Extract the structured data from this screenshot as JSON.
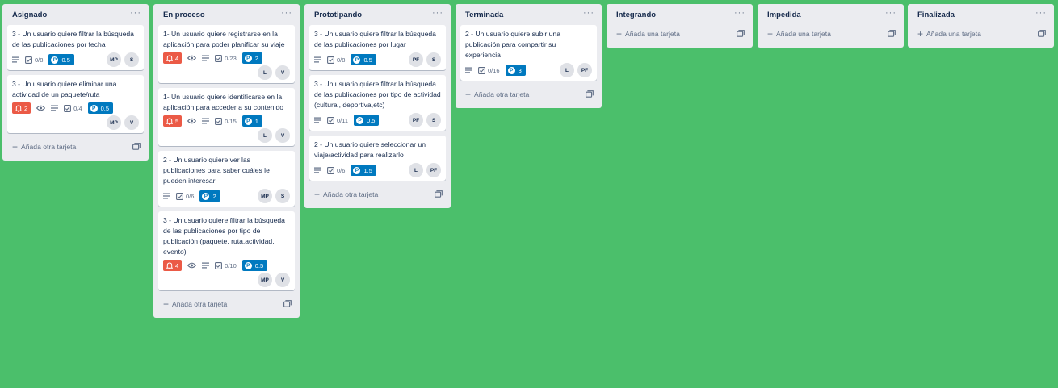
{
  "lists": [
    {
      "title": "Asignado",
      "cards": [
        {
          "title": "3 - Un usuario quiere filtrar la búsqueda de las publicaciones por fecha",
          "alert": null,
          "watch": false,
          "desc": true,
          "checklist": "0/8",
          "points": "0.5",
          "members": [
            "MP",
            "S"
          ],
          "members_inline": true
        },
        {
          "title": "3 - Un usuario quiere eliminar una actividad de un paquete/ruta",
          "alert": "2",
          "watch": true,
          "desc": true,
          "checklist": "0/4",
          "points": "0.5",
          "members": [
            "MP",
            "V"
          ],
          "members_inline": false
        }
      ],
      "add_label": "Añada otra tarjeta"
    },
    {
      "title": "En proceso",
      "cards": [
        {
          "title": "1- Un usuario quiere registrarse en la aplicación para poder planificar su viaje",
          "alert": "4",
          "watch": true,
          "desc": true,
          "checklist": "0/23",
          "points": "2",
          "members": [
            "L",
            "V"
          ],
          "members_inline": false
        },
        {
          "title": "1- Un usuario quiere identificarse en la aplicación para acceder a su contenido",
          "alert": "5",
          "watch": true,
          "desc": true,
          "checklist": "0/15",
          "points": "1",
          "members": [
            "L",
            "V"
          ],
          "members_inline": false
        },
        {
          "title": "2 - Un usuario quiere ver las publicaciones para saber cuáles le pueden interesar",
          "alert": null,
          "watch": false,
          "desc": true,
          "checklist": "0/6",
          "points": "2",
          "members": [
            "MP",
            "S"
          ],
          "members_inline": true
        },
        {
          "title": "3 - Un usuario quiere filtrar la búsqueda de las publicaciones por tipo de publicación (paquete, ruta,actividad, evento)",
          "alert": "4",
          "watch": true,
          "desc": true,
          "checklist": "0/10",
          "points": "0.5",
          "members": [
            "MP",
            "V"
          ],
          "members_inline": false
        }
      ],
      "add_label": "Añada otra tarjeta"
    },
    {
      "title": "Prototipando",
      "cards": [
        {
          "title": "3 - Un usuario quiere filtrar la búsqueda de las publicaciones por lugar",
          "alert": null,
          "watch": false,
          "desc": true,
          "checklist": "0/8",
          "points": "0.5",
          "members": [
            "PF",
            "S"
          ],
          "members_inline": true
        },
        {
          "title": "3 - Un usuario quiere filtrar la búsqueda de las publicaciones por tipo de actividad (cultural, deportiva,etc)",
          "alert": null,
          "watch": false,
          "desc": true,
          "checklist": "0/11",
          "points": "0.5",
          "members": [
            "PF",
            "S"
          ],
          "members_inline": true
        },
        {
          "title": "2 - Un usuario quiere seleccionar un viaje/actividad para realizarlo",
          "alert": null,
          "watch": false,
          "desc": true,
          "checklist": "0/6",
          "points": "1.5",
          "members": [
            "L",
            "PF"
          ],
          "members_inline": true
        }
      ],
      "add_label": "Añada otra tarjeta"
    },
    {
      "title": "Terminada",
      "cards": [
        {
          "title": "2 - Un usuario quiere subir una publicación para compartir su experiencia",
          "alert": null,
          "watch": false,
          "desc": true,
          "checklist": "0/16",
          "points": "3",
          "members": [
            "L",
            "PF"
          ],
          "members_inline": true
        }
      ],
      "add_label": "Añada otra tarjeta"
    },
    {
      "title": "Integrando",
      "cards": [],
      "add_label": "Añada una tarjeta"
    },
    {
      "title": "Impedida",
      "cards": [],
      "add_label": "Añada una tarjeta"
    },
    {
      "title": "Finalizada",
      "cards": [],
      "add_label": "Añada una tarjeta"
    }
  ],
  "icons": {
    "menu": "ellipsis-icon",
    "description": "description-icon",
    "checklist": "checklist-icon",
    "watch": "eye-icon",
    "alert": "bell-icon",
    "points": "points-icon",
    "template": "card-template-icon",
    "add": "plus-icon"
  },
  "colors": {
    "board_bg": "#4bbf6b",
    "list_bg": "#ebecf0",
    "points_badge": "#0079bf",
    "alert_badge": "#eb5a46"
  }
}
